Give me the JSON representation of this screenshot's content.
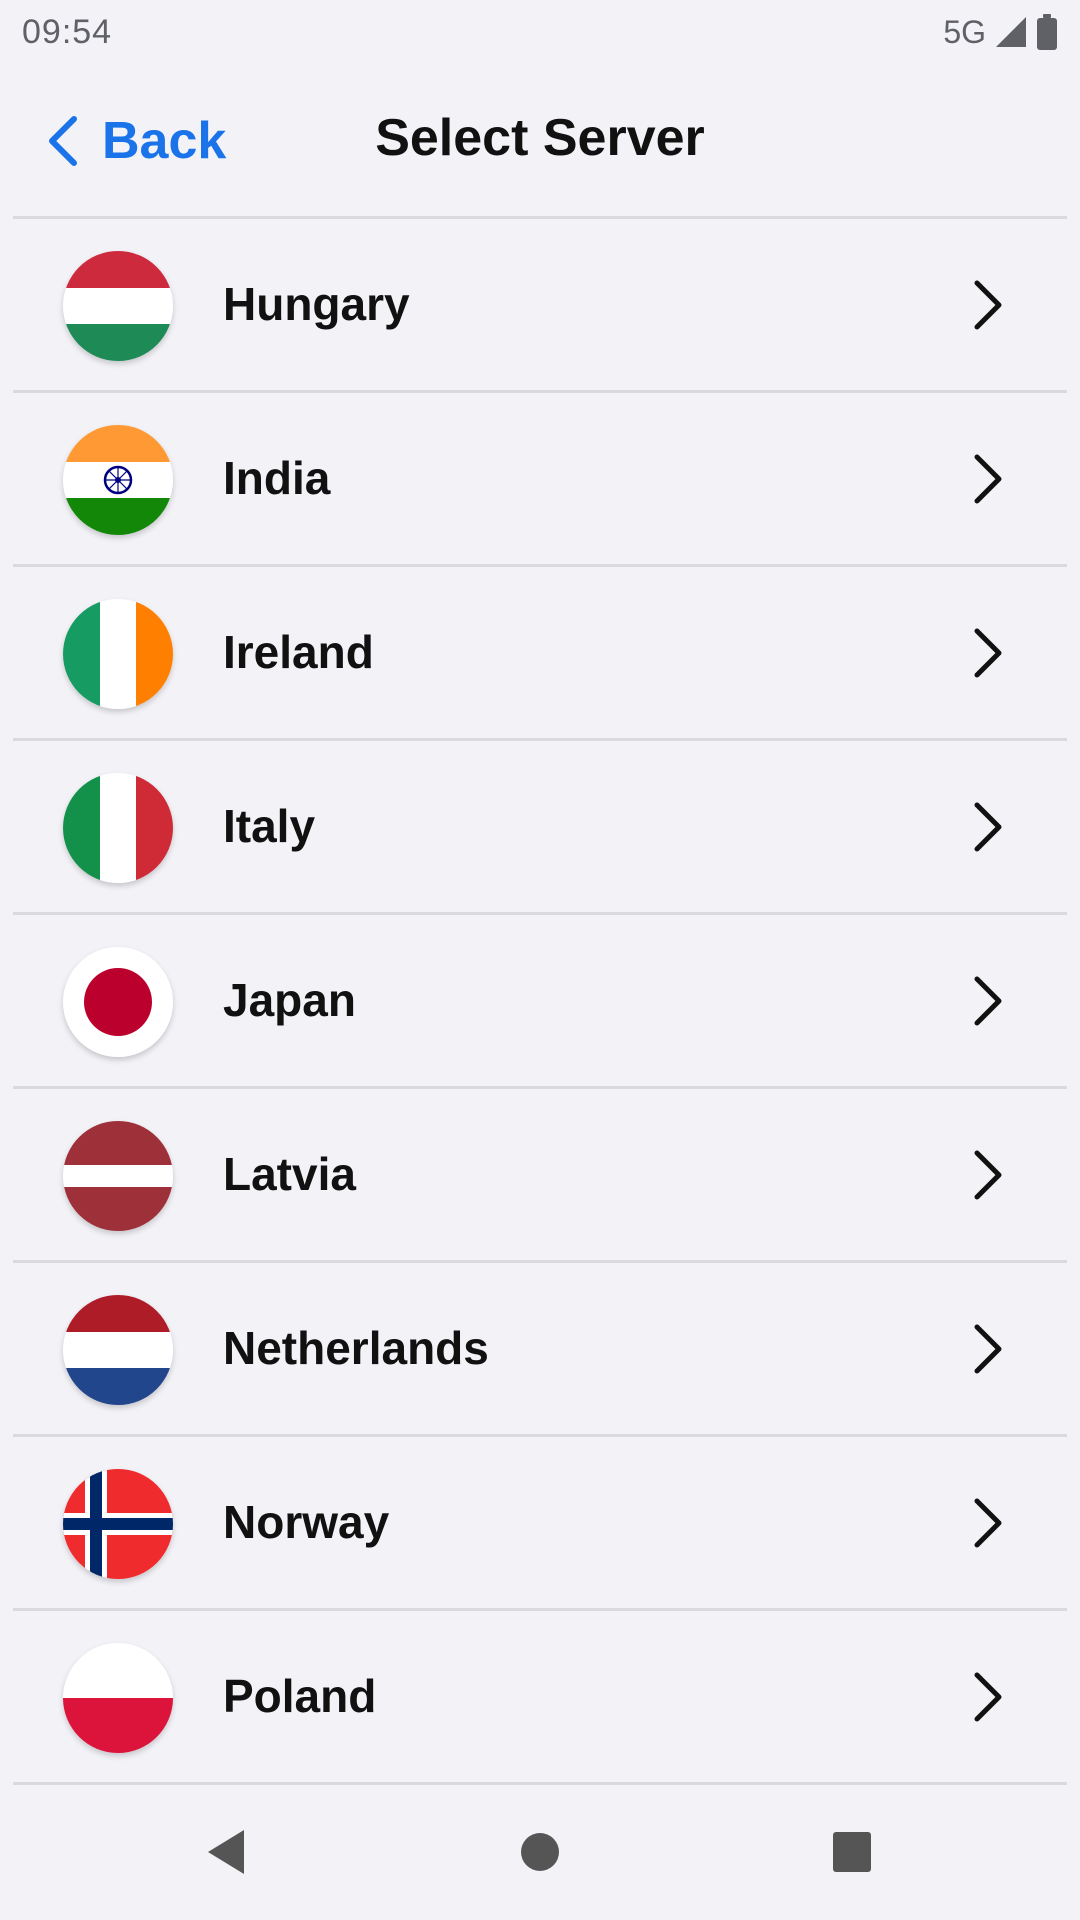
{
  "status_bar": {
    "time": "09:54",
    "network": "5G"
  },
  "nav": {
    "back_label": "Back",
    "title": "Select Server"
  },
  "servers": [
    {
      "name": "Hungary",
      "flag": "hungary-flag"
    },
    {
      "name": "India",
      "flag": "india-flag"
    },
    {
      "name": "Ireland",
      "flag": "ireland-flag"
    },
    {
      "name": "Italy",
      "flag": "italy-flag"
    },
    {
      "name": "Japan",
      "flag": "japan-flag"
    },
    {
      "name": "Latvia",
      "flag": "latvia-flag"
    },
    {
      "name": "Netherlands",
      "flag": "netherlands-flag"
    },
    {
      "name": "Norway",
      "flag": "norway-flag"
    },
    {
      "name": "Poland",
      "flag": "poland-flag"
    }
  ],
  "colors": {
    "accent": "#1a73e8",
    "background": "#f2f2f7",
    "divider": "#d9d9de"
  }
}
